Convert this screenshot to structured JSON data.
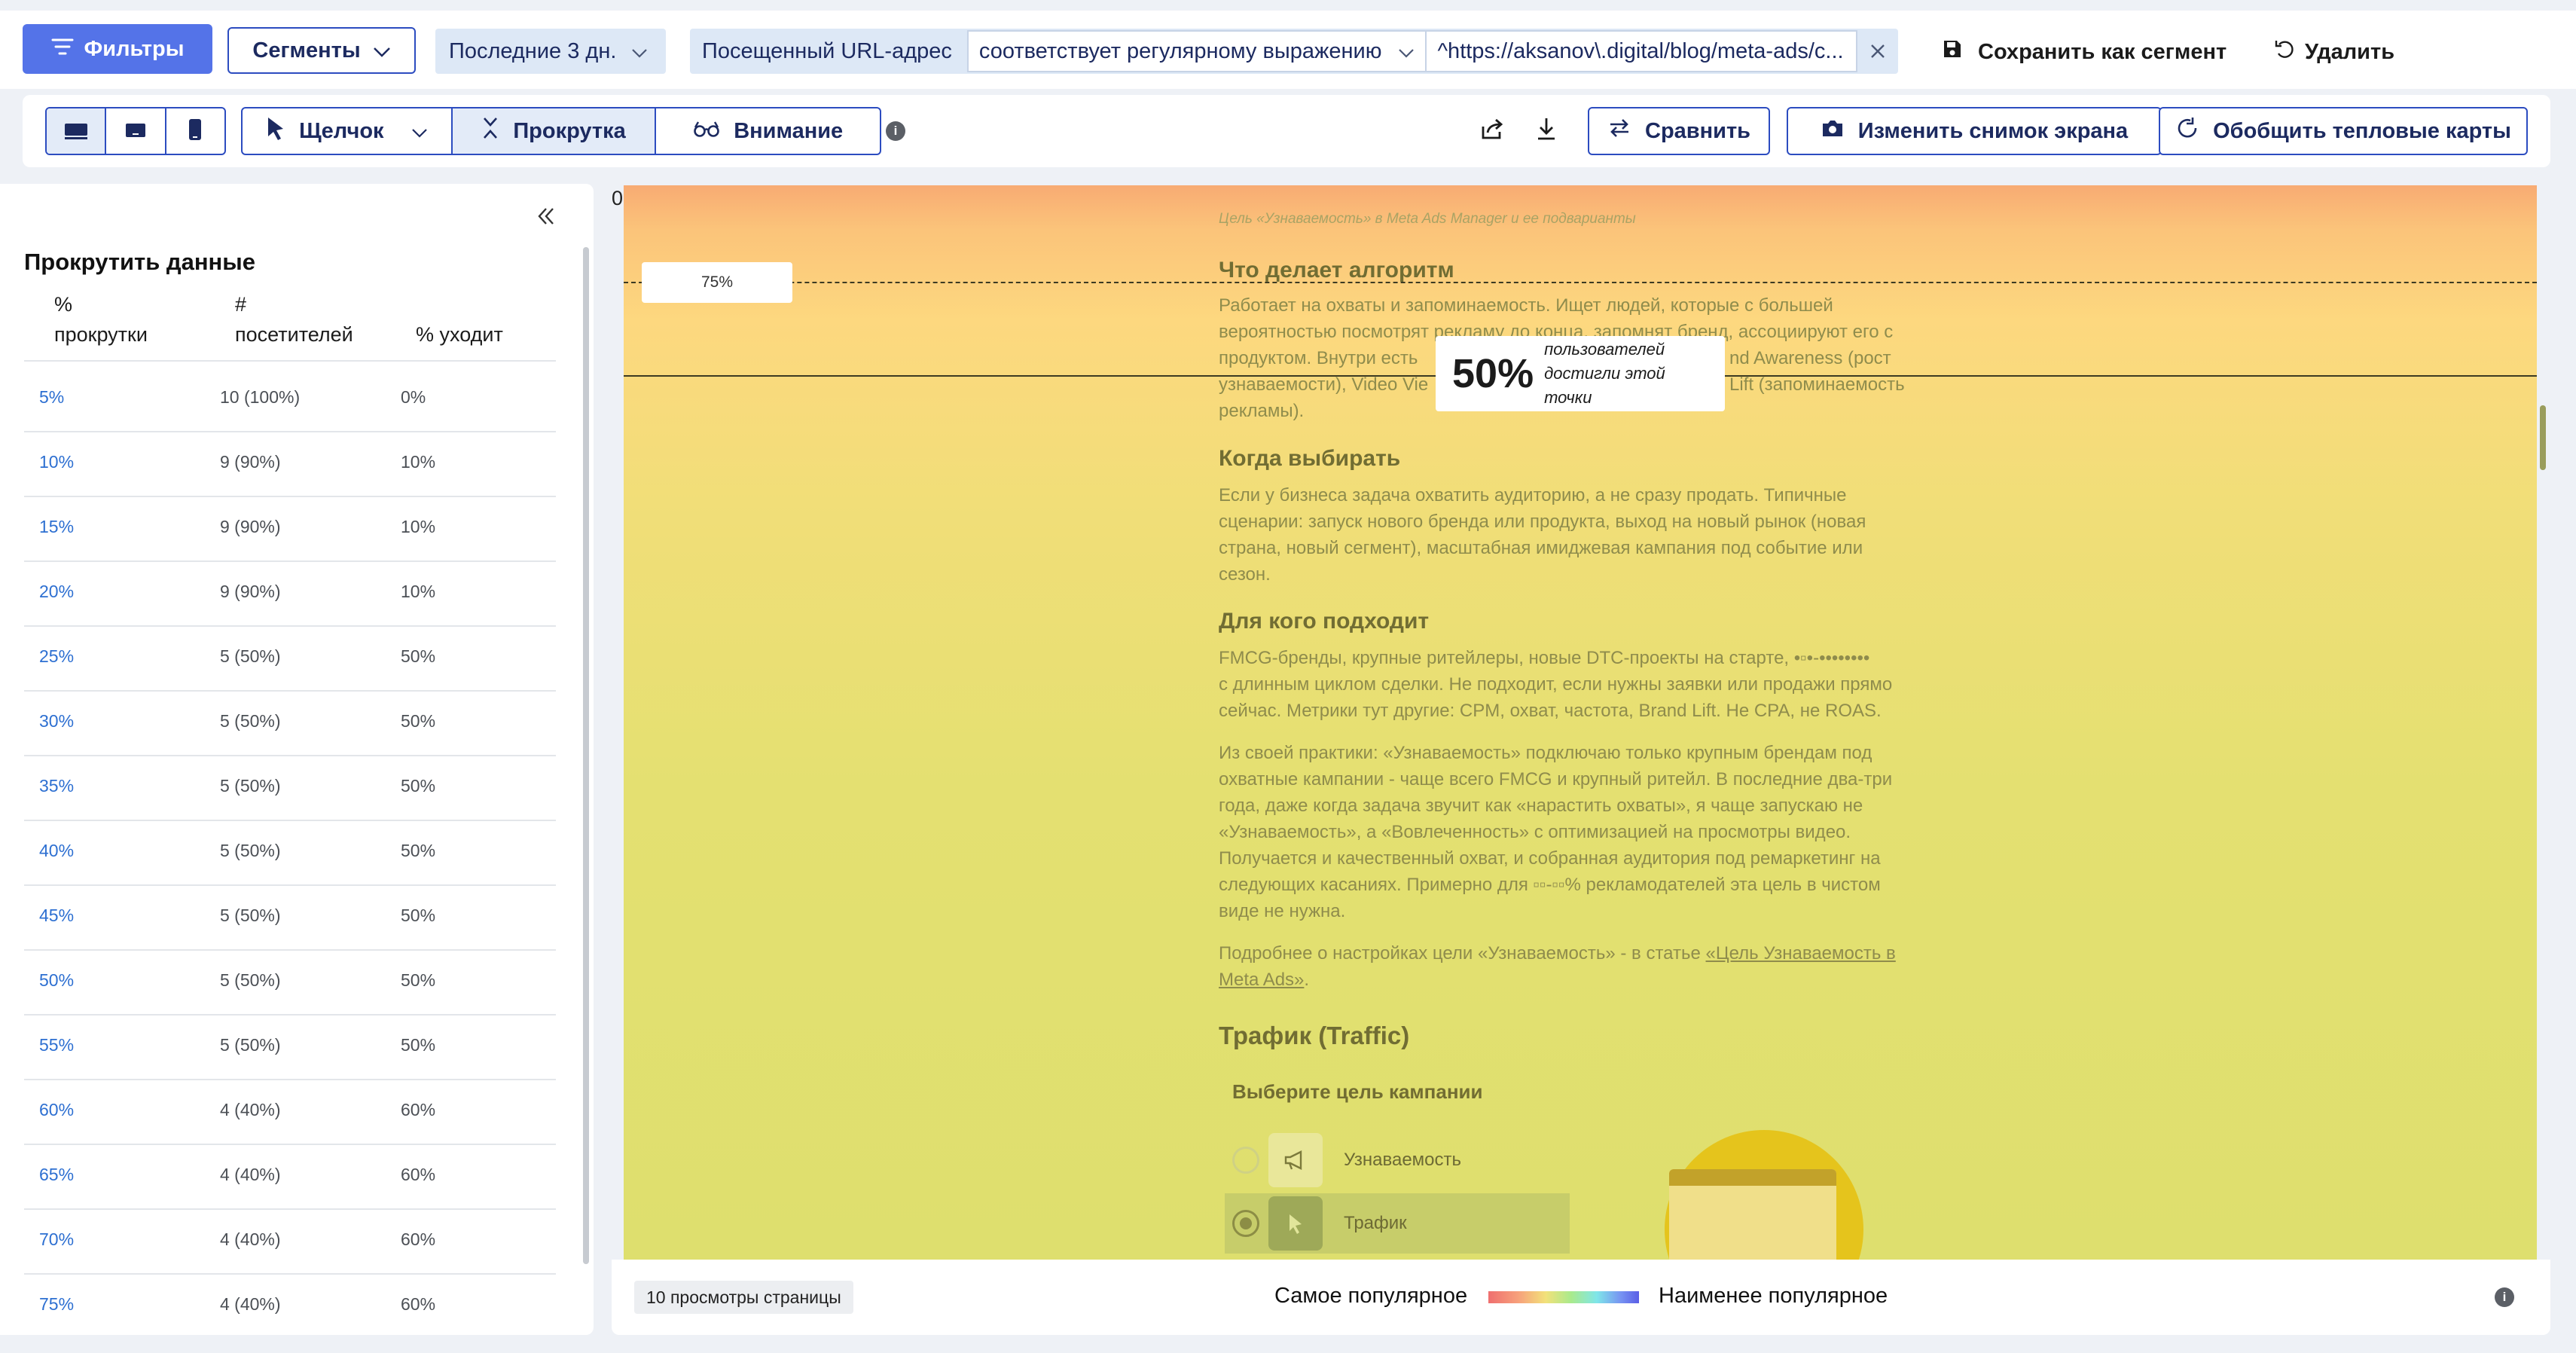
{
  "filter_bar": {
    "filters_label": "Фильтры",
    "segments_label": "Сегменты",
    "date_range": "Последние 3 дн.",
    "url_filter": {
      "label": "Посещенный URL-адрес",
      "operator": "соответствует регулярному выражению",
      "value": "^https://aksanov\\.digital/blog/meta-ads/c..."
    },
    "save_segment_label": "Сохранить как сегмент",
    "delete_label": "Удалить"
  },
  "toolbar": {
    "devices": [
      "desktop",
      "tablet",
      "mobile"
    ],
    "active_device": "desktop",
    "modes": {
      "click": "Щелчок",
      "scroll": "Прокрутка",
      "attention": "Внимание"
    },
    "active_mode": "scroll",
    "compare_label": "Сравнить",
    "change_screenshot_label": "Изменить снимок экрана",
    "aggregate_label": "Обобщить тепловые карты"
  },
  "scroll_panel": {
    "title": "Прокрутить данные",
    "columns": [
      "% прокрутки",
      "# посетителей",
      "% уходит"
    ],
    "col1_line1": "%",
    "col1_line2": "прокрутки",
    "col2_line1": "#",
    "col2_line2": "посетителей",
    "col3": "% уходит",
    "rows": [
      {
        "pct": "5%",
        "visitors": "10 (100%)",
        "drop": "0%"
      },
      {
        "pct": "10%",
        "visitors": "9 (90%)",
        "drop": "10%"
      },
      {
        "pct": "15%",
        "visitors": "9 (90%)",
        "drop": "10%"
      },
      {
        "pct": "20%",
        "visitors": "9 (90%)",
        "drop": "10%"
      },
      {
        "pct": "25%",
        "visitors": "5 (50%)",
        "drop": "50%"
      },
      {
        "pct": "30%",
        "visitors": "5 (50%)",
        "drop": "50%"
      },
      {
        "pct": "35%",
        "visitors": "5 (50%)",
        "drop": "50%"
      },
      {
        "pct": "40%",
        "visitors": "5 (50%)",
        "drop": "50%"
      },
      {
        "pct": "45%",
        "visitors": "5 (50%)",
        "drop": "50%"
      },
      {
        "pct": "50%",
        "visitors": "5 (50%)",
        "drop": "50%"
      },
      {
        "pct": "55%",
        "visitors": "5 (50%)",
        "drop": "50%"
      },
      {
        "pct": "60%",
        "visitors": "4 (40%)",
        "drop": "60%"
      },
      {
        "pct": "65%",
        "visitors": "4 (40%)",
        "drop": "60%"
      },
      {
        "pct": "70%",
        "visitors": "4 (40%)",
        "drop": "60%"
      },
      {
        "pct": "75%",
        "visitors": "4 (40%)",
        "drop": "60%"
      }
    ]
  },
  "heatmap": {
    "zero_label": "0",
    "marker_75": "75%",
    "marker_50_value": "50%",
    "marker_50_text": "пользователей достигли этой точки",
    "page": {
      "caption": "Цель «Узнаваемость» в Meta Ads Manager и ее подварианты",
      "h_algo": "Что делает алгоритм",
      "p_algo_1": "Работает на охваты и запоминаемость. Ищет людей, которые с большей",
      "p_algo_2": "вероятностью посмотрят рекламу до конца, запомнят бренд, ассоциируют его с",
      "p_algo_3": "продуктом. Внутри есть",
      "p_algo_3b": "nd Awareness (рост",
      "p_algo_4": "узнаваемости), Video Vie",
      "p_algo_4b": "Lift (запоминаемость",
      "p_algo_5": "рекламы).",
      "h_when": "Когда выбирать",
      "p_when_1": "Если у бизнеса задача охватить аудиторию, а не сразу продать. Типичные",
      "p_when_2": "сценарии: запуск нового бренда или продукта, выход на новый рынок (новая",
      "p_when_3": "страна, новый сегмент), масштабная имиджевая кампания под событие или",
      "p_when_4": "сезон.",
      "h_for": "Для кого подходит",
      "p_for_1": "FMCG-бренды, крупные ритейлеры, новые DTC-проекты на старте, •▫•-••••••••",
      "p_for_2": "с длинным циклом сделки. Не подходит, если нужны заявки или продажи прямо",
      "p_for_3": "сейчас. Метрики тут другие: CPM, охват, частота, Brand Lift. Не CPA, не ROAS.",
      "p_prac_1": "Из своей практики: «Узнаваемость» подключаю только крупным брендам под",
      "p_prac_2": "охватные кампании - чаще всего FMCG и крупный ритейл. В последние два-три",
      "p_prac_3": "года, даже когда задача звучит как «нарастить охваты», я чаще запускаю не",
      "p_prac_4": "«Узнаваемость», а «Вовлеченность» с оптимизацией на просмотры видео.",
      "p_prac_5": "Получается и качественный охват, и собранная аудитория под ремаркетинг на",
      "p_prac_6": "следующих касаниях. Примерно для ▫▫-▫▫% рекламодателей эта цель в чистом",
      "p_prac_7": "виде не нужна.",
      "p_more_1": "Подробнее о настройках цели «Узнаваемость» - в статье ",
      "p_more_link_1": "«Цель Узнаваемость в",
      "p_more_link_2": "Meta Ads»",
      "p_more_2_tail": ".",
      "h_traffic": "Трафик (Traffic)",
      "widget_title": "Выберите цель кампании",
      "opt_awareness": "Узнаваемость",
      "opt_traffic": "Трафик"
    }
  },
  "legend": {
    "views": "10 просмотры страницы",
    "most": "Самое популярное",
    "least": "Наименее популярное"
  }
}
